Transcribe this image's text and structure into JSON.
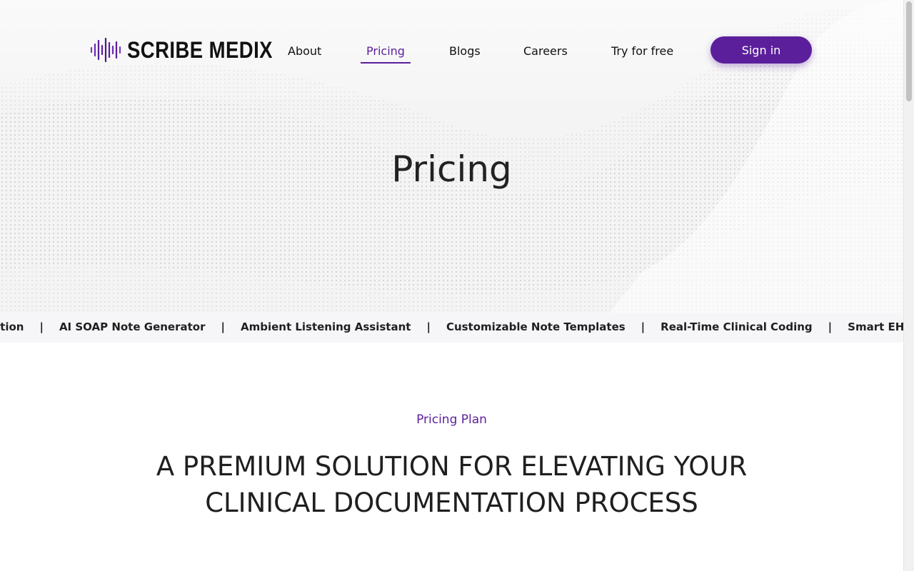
{
  "brand": {
    "name": "SCRIBE MEDIX",
    "accent": "#5b1f9c"
  },
  "nav": {
    "items": [
      {
        "label": "About"
      },
      {
        "label": "Pricing",
        "active": true
      },
      {
        "label": "Blogs"
      },
      {
        "label": "Careers"
      },
      {
        "label": "Try for free"
      }
    ],
    "signin_label": "Sign in"
  },
  "hero": {
    "title": "Pricing"
  },
  "ticker": {
    "separator": "|",
    "items": [
      "entation",
      "AI SOAP Note Generator",
      "Ambient Listening Assistant",
      "Customizable Note Templates",
      "Real-Time Clinical Coding",
      "Smart EHR Auto"
    ]
  },
  "section": {
    "kicker": "Pricing Plan",
    "title_line1": "A PREMIUM SOLUTION FOR ELEVATING YOUR",
    "title_line2": "CLINICAL DOCUMENTATION PROCESS"
  }
}
